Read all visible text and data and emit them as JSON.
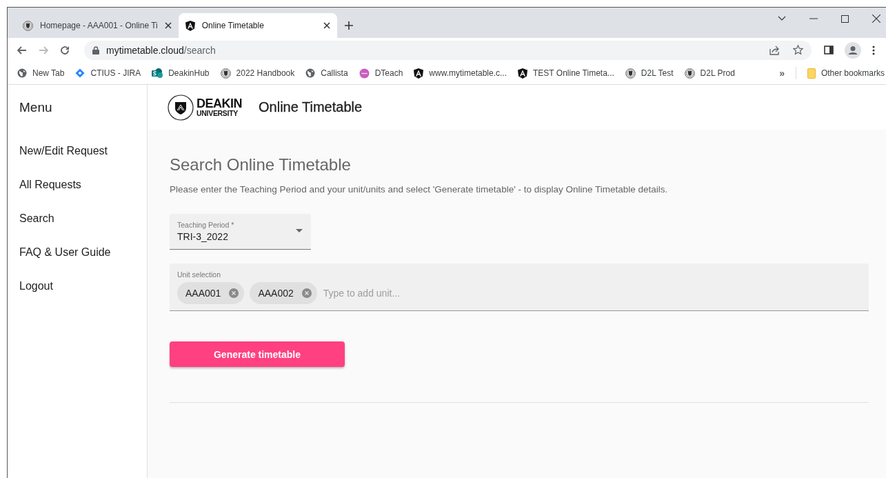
{
  "browser": {
    "tabs": [
      {
        "title": "Homepage - AAA001 - Online Ti",
        "selected": false,
        "kind": "crest"
      },
      {
        "title": "Online Timetable",
        "selected": true,
        "kind": "angular"
      }
    ],
    "url_host": "mytimetable.cloud",
    "url_path": "/search",
    "bookmarks": [
      {
        "label": "New Tab",
        "kind": "globe"
      },
      {
        "label": "CTIUS - JIRA",
        "kind": "diamond"
      },
      {
        "label": "DeakinHub",
        "kind": "sharepoint"
      },
      {
        "label": "2022 Handbook",
        "kind": "crest"
      },
      {
        "label": "Callista",
        "kind": "globe"
      },
      {
        "label": "DTeach",
        "kind": "dteach"
      },
      {
        "label": "www.mytimetable.c...",
        "kind": "angular"
      },
      {
        "label": "TEST Online Timeta...",
        "kind": "angular"
      },
      {
        "label": "D2L Test",
        "kind": "crest"
      },
      {
        "label": "D2L Prod",
        "kind": "crest"
      }
    ],
    "bookmarks_more": "»",
    "other_bookmarks": "Other bookmarks"
  },
  "sidebar": {
    "title": "Menu",
    "items": [
      "New/Edit Request",
      "All Requests",
      "Search",
      "FAQ & User Guide",
      "Logout"
    ]
  },
  "header": {
    "logo_top": "DEAKIN",
    "logo_bottom": "UNIVERSITY",
    "title": "Online Timetable"
  },
  "page": {
    "heading": "Search Online Timetable",
    "instructions": "Please enter the Teaching Period and your unit/units and select 'Generate timetable' - to display Online Timetable details.",
    "teaching_period": {
      "label": "Teaching Period *",
      "value": "TRI-3_2022"
    },
    "unit_selection": {
      "label": "Unit selection",
      "chips": [
        "AAA001",
        "AAA002"
      ],
      "placeholder": "Type to add unit..."
    },
    "button": "Generate timetable"
  }
}
